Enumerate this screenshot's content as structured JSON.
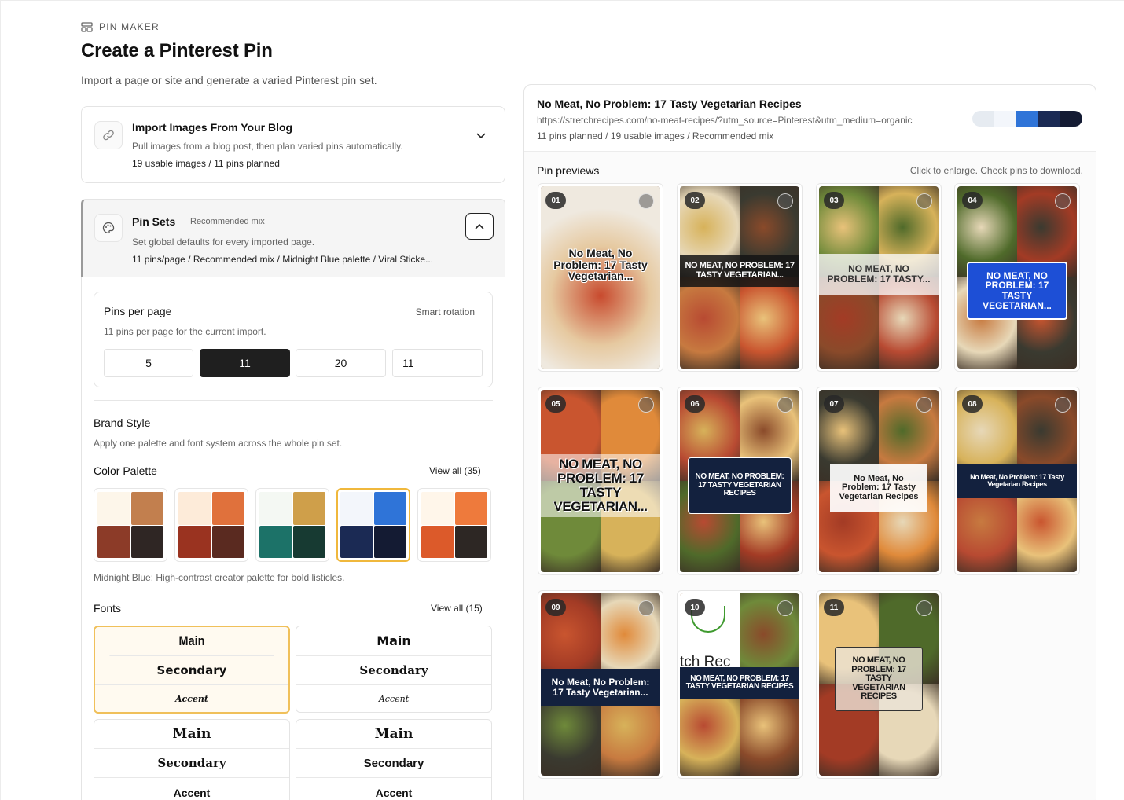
{
  "header": {
    "eyebrow": "PIN MAKER",
    "title": "Create a Pinterest Pin",
    "subtitle": "Import a page or site and generate a varied Pinterest pin set."
  },
  "import_card": {
    "title": "Import Images From Your Blog",
    "description": "Pull images from a blog post, then plan varied pins automatically.",
    "meta": "19 usable images / 11 pins planned"
  },
  "pin_sets": {
    "title": "Pin Sets",
    "tag": "Recommended mix",
    "description": "Set global defaults for every imported page.",
    "meta": "11 pins/page / Recommended mix / Midnight Blue palette / Viral Sticke..."
  },
  "pins_per_page": {
    "title": "Pins per page",
    "tag": "Smart rotation",
    "description": "11 pins per page for the current import.",
    "options": [
      "5",
      "11",
      "20"
    ],
    "selected": "11",
    "custom_value": "11"
  },
  "brand_style": {
    "title": "Brand Style",
    "description": "Apply one palette and font system across the whole pin set."
  },
  "color_palette": {
    "title": "Color Palette",
    "view_all": "View all (35)",
    "caption": "Midnight Blue: High-contrast creator palette for bold listicles.",
    "palettes": [
      [
        "#fdf6ea",
        "#c27f4e",
        "#8c3b28",
        "#2f2624"
      ],
      [
        "#fdebd9",
        "#e0713c",
        "#9a3320",
        "#5a2a20"
      ],
      [
        "#f4f8f3",
        "#cf9f4a",
        "#1c7268",
        "#173a32"
      ],
      [
        "#f3f6fb",
        "#2f74d8",
        "#1b2a54",
        "#141b33"
      ],
      [
        "#fff6ea",
        "#ee7a3c",
        "#dc5a2a",
        "#2d2724"
      ]
    ],
    "selected_index": 3
  },
  "fonts": {
    "title": "Fonts",
    "view_all": "View all (15)",
    "sets": [
      {
        "main": "Main",
        "secondary": "Secondary",
        "accent": "Accent"
      },
      {
        "main": "Main",
        "secondary": "Secondary",
        "accent": "Accent"
      },
      {
        "main": "Main",
        "secondary": "Secondary",
        "accent": "Accent"
      },
      {
        "main": "Main",
        "secondary": "Secondary",
        "accent": "Accent"
      }
    ]
  },
  "preview": {
    "title": "No Meat, No Problem: 17 Tasty Vegetarian Recipes",
    "url": "https://stretchrecipes.com/no-meat-recipes/?utm_source=Pinterest&utm_medium=organic",
    "meta": "11 pins planned / 19 usable images / Recommended mix",
    "palette_bar": [
      "#e6ebf1",
      "#f3f6fb",
      "#2f74d8",
      "#1b2a54",
      "#141b33"
    ],
    "section_title": "Pin previews",
    "hint": "Click to enlarge. Check pins to download.",
    "pins": [
      {
        "num": "01",
        "text": "No Meat, No Problem: 17 Tasty Vegetarian..."
      },
      {
        "num": "02",
        "text": "NO MEAT, NO PROBLEM: 17 TASTY VEGETARIAN..."
      },
      {
        "num": "03",
        "text": "NO MEAT, NO PROBLEM: 17 TASTY..."
      },
      {
        "num": "04",
        "text": "NO MEAT, NO PROBLEM: 17 TASTY VEGETARIAN..."
      },
      {
        "num": "05",
        "text": "NO MEAT, NO PROBLEM: 17 TASTY VEGETARIAN..."
      },
      {
        "num": "06",
        "text": "NO MEAT, NO PROBLEM: 17 TASTY VEGETARIAN RECIPES"
      },
      {
        "num": "07",
        "text": "No Meat, No Problem: 17 Tasty Vegetarian Recipes"
      },
      {
        "num": "08",
        "text": "No Meat, No Problem: 17 Tasty Vegetarian Recipes"
      },
      {
        "num": "09",
        "text": "No Meat, No Problem: 17 Tasty Vegetarian..."
      },
      {
        "num": "10",
        "text": "NO MEAT, NO PROBLEM: 17 TASTY VEGETARIAN RECIPES",
        "logo_text": "tch Rec"
      },
      {
        "num": "11",
        "text": "NO MEAT, NO PROBLEM: 17 TASTY VEGETARIAN RECIPES"
      }
    ]
  }
}
